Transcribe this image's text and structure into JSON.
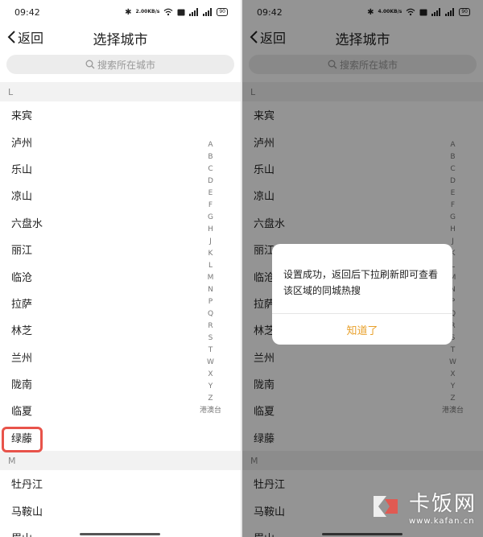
{
  "status": {
    "time": "09:42",
    "left_speed": "2.00",
    "right_speed": "4.00",
    "speed_unit": "KB/s",
    "battery": "90"
  },
  "nav": {
    "back_label": "返回",
    "title": "选择城市"
  },
  "search": {
    "placeholder": "搜索所在城市"
  },
  "sections": {
    "L": {
      "letter": "L",
      "cities": [
        "来宾",
        "泸州",
        "乐山",
        "凉山",
        "六盘水",
        "丽江",
        "临沧",
        "拉萨",
        "林芝",
        "兰州",
        "陇南",
        "临夏",
        "绿藤"
      ]
    },
    "M": {
      "letter": "M",
      "cities": [
        "牡丹江",
        "马鞍山",
        "眉山"
      ]
    }
  },
  "index_letters": [
    "A",
    "B",
    "C",
    "D",
    "E",
    "F",
    "G",
    "H",
    "J",
    "K",
    "L",
    "M",
    "N",
    "P",
    "Q",
    "R",
    "S",
    "T",
    "W",
    "X",
    "Y",
    "Z"
  ],
  "index_last": "港澳台",
  "dialog": {
    "message": "设置成功，返回后下拉刷新即可查看该区域的同城热搜",
    "button": "知道了"
  },
  "watermark": {
    "name": "卡饭网",
    "domain": "www.kafan.cn"
  },
  "colors": {
    "highlight": "#e8534a",
    "dialog_button": "#e8a02a",
    "section_bg": "#f2f2f2"
  }
}
